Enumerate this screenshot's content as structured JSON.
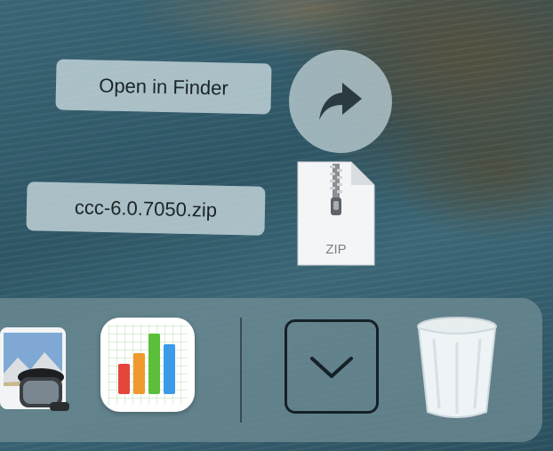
{
  "drag_overlay": {
    "action_label": "Open in Finder",
    "file_name": "ccc-6.0.7050.zip",
    "file_type_label": "ZIP",
    "action_icon": "share-arrow-icon",
    "file_icon": "zip-file-icon"
  },
  "dock": {
    "items": [
      {
        "name": "Preview",
        "icon": "preview-app-icon"
      },
      {
        "name": "Numbers",
        "icon": "numbers-app-icon"
      },
      {
        "name": "Downloads",
        "icon": "chevron-down-icon"
      },
      {
        "name": "Trash",
        "icon": "trash-icon"
      }
    ]
  },
  "colors": {
    "overlay_pill": "#c4d6da",
    "dock_bg": "#6e8c94",
    "numbers_bars": [
      "#e5463b",
      "#f09a2e",
      "#5cbf3a",
      "#3b9be8"
    ]
  }
}
